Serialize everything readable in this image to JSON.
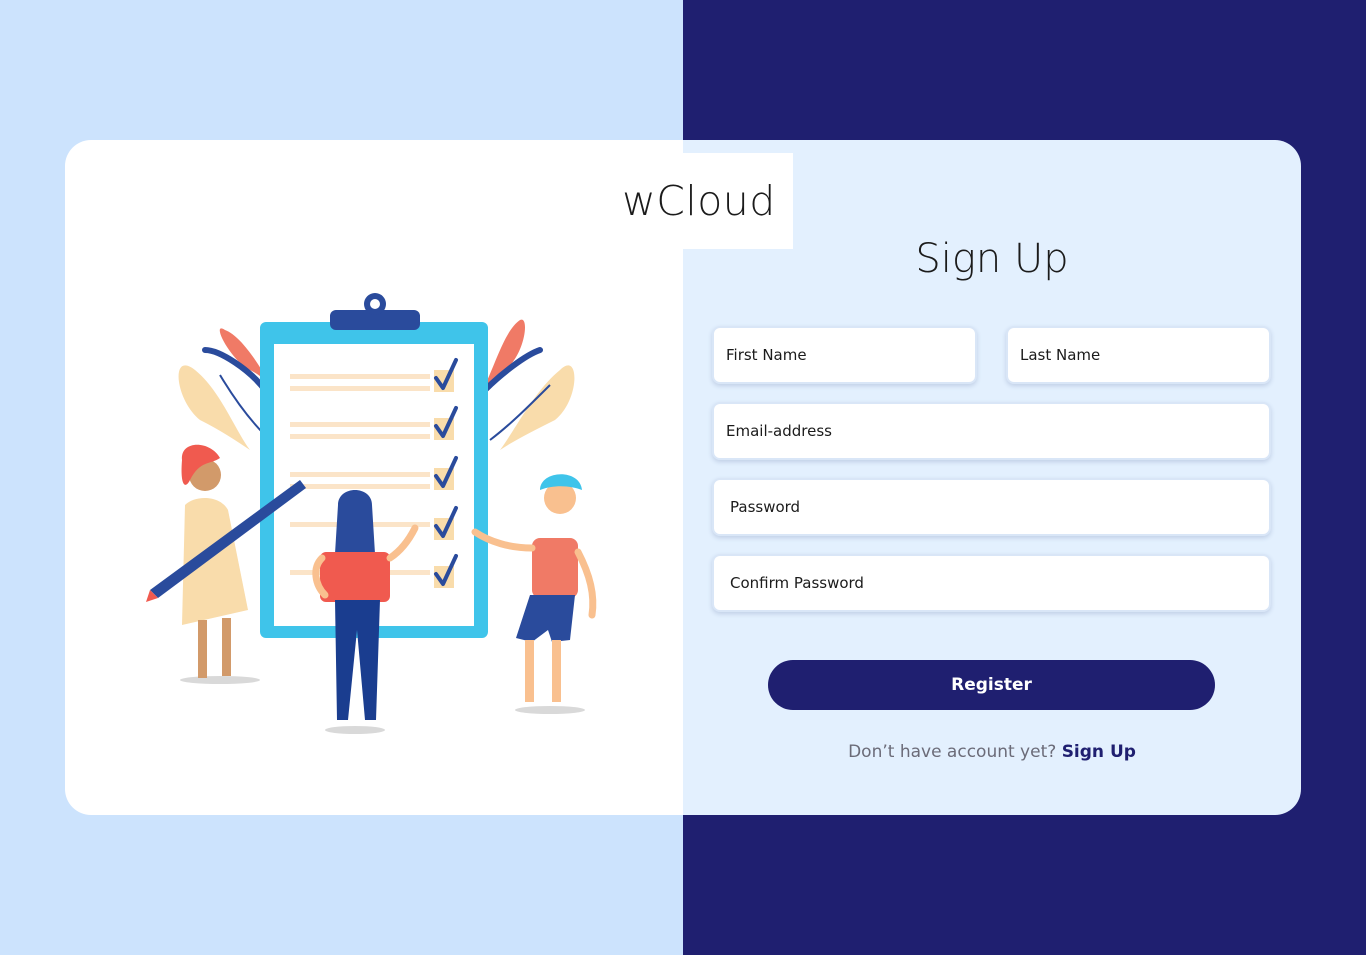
{
  "brand": {
    "name": "wCloud"
  },
  "form": {
    "title": "Sign Up",
    "first_name_placeholder": "First Name",
    "last_name_placeholder": "Last Name",
    "email_placeholder": "Email-address",
    "password_placeholder": "Password",
    "confirm_password_placeholder": "Confirm Password",
    "register_label": "Register",
    "footer_text": "Don’t have account yet?",
    "footer_link": "Sign Up"
  },
  "colors": {
    "left_background": "#cce3fd",
    "right_background": "#1f1f70",
    "form_panel": "#e3f0fe",
    "accent": "#1f1f70"
  },
  "illustration": {
    "icon": "checklist-team-illustration"
  }
}
